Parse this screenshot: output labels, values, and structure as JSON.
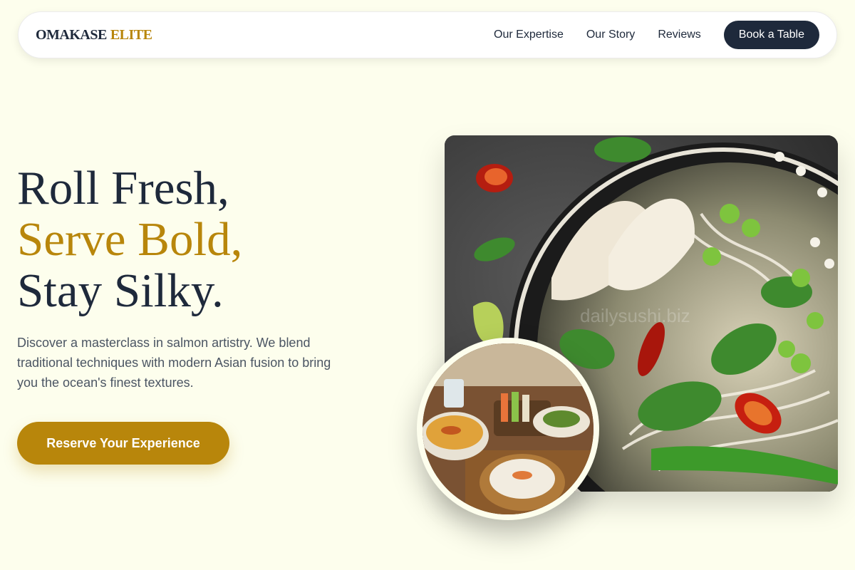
{
  "nav": {
    "logo_primary": "OMAKASE",
    "logo_accent": "ELITE",
    "links": [
      "Our Expertise",
      "Our Story",
      "Reviews"
    ],
    "cta": "Book a Table"
  },
  "hero": {
    "title_line1": "Roll Fresh,",
    "title_line2": "Serve Bold,",
    "title_line3": "Stay Silky.",
    "description": "Discover a masterclass in salmon artistry. We blend traditional techniques with modern Asian fusion to bring you the ocean's finest textures.",
    "cta": "Reserve Your Experience"
  },
  "images": {
    "main_watermark": "dailysushi.biz",
    "main_icon": "noodle-bowl-photo",
    "round_icon": "asian-dishes-photo"
  },
  "colors": {
    "background": "#fdfeed",
    "navy": "#1e293b",
    "gold": "#b8860b"
  }
}
